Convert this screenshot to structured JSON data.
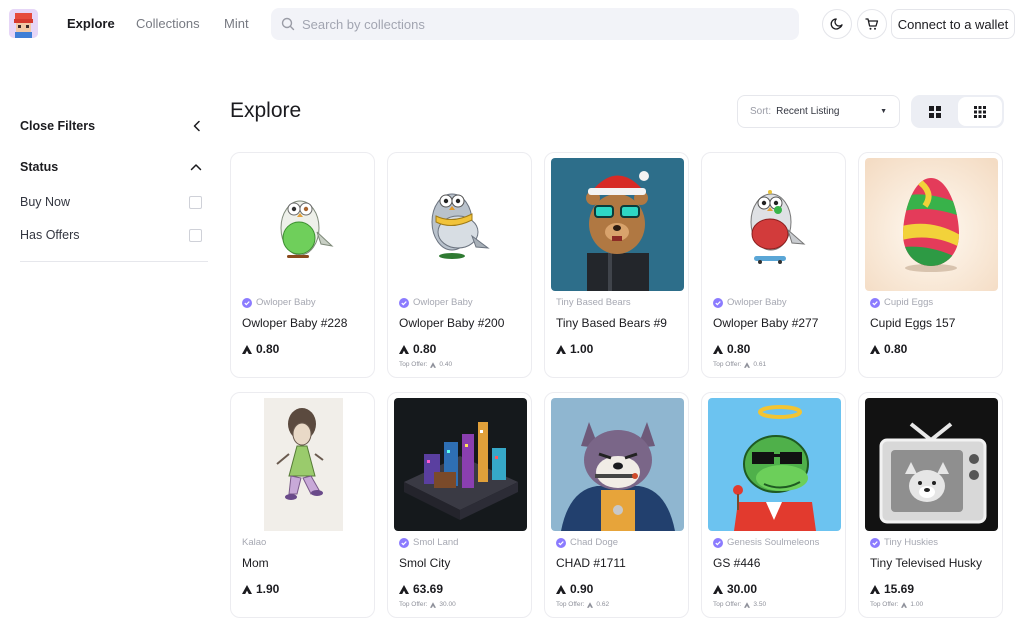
{
  "nav": {
    "links": [
      "Explore",
      "Collections",
      "Mint"
    ],
    "search_placeholder": "Search by collections",
    "wallet_label": "Connect to a wallet"
  },
  "sidebar": {
    "close_filters": "Close Filters",
    "status_title": "Status",
    "options": [
      "Buy Now",
      "Has Offers"
    ]
  },
  "main": {
    "title": "Explore",
    "sort_label": "Sort:",
    "sort_value": "Recent Listing"
  },
  "colors": {
    "accent": "#8b7bff",
    "card_border": "#ececf0",
    "muted": "#a6a8b2"
  },
  "cards": [
    {
      "collection": "Owloper Baby",
      "verified": true,
      "name": "Owloper Baby #228",
      "price": "0.80",
      "top_offer_label": "",
      "top_offer": ""
    },
    {
      "collection": "Owloper Baby",
      "verified": true,
      "name": "Owloper Baby #200",
      "price": "0.80",
      "top_offer_label": "Top Offer:",
      "top_offer": "0.40"
    },
    {
      "collection": "Tiny Based Bears",
      "verified": false,
      "name": "Tiny Based Bears #9",
      "price": "1.00",
      "top_offer_label": "",
      "top_offer": ""
    },
    {
      "collection": "Owloper Baby",
      "verified": true,
      "name": "Owloper Baby #277",
      "price": "0.80",
      "top_offer_label": "Top Offer:",
      "top_offer": "0.61"
    },
    {
      "collection": "Cupid Eggs",
      "verified": true,
      "name": "Cupid Eggs 157",
      "price": "0.80",
      "top_offer_label": "",
      "top_offer": ""
    },
    {
      "collection": "Kalao",
      "verified": false,
      "name": "Mom",
      "price": "1.90",
      "top_offer_label": "",
      "top_offer": ""
    },
    {
      "collection": "Smol Land",
      "verified": true,
      "name": "Smol City",
      "price": "63.69",
      "top_offer_label": "Top Offer:",
      "top_offer": "30.00"
    },
    {
      "collection": "Chad Doge",
      "verified": true,
      "name": "CHAD #1711",
      "price": "0.90",
      "top_offer_label": "Top Offer:",
      "top_offer": "0.62"
    },
    {
      "collection": "Genesis Soulmeleons",
      "verified": true,
      "name": "GS #446",
      "price": "30.00",
      "top_offer_label": "Top Offer:",
      "top_offer": "3.50"
    },
    {
      "collection": "Tiny Huskies",
      "verified": true,
      "name": "Tiny Televised Husky",
      "price": "15.69",
      "top_offer_label": "Top Offer:",
      "top_offer": "1.00"
    }
  ]
}
